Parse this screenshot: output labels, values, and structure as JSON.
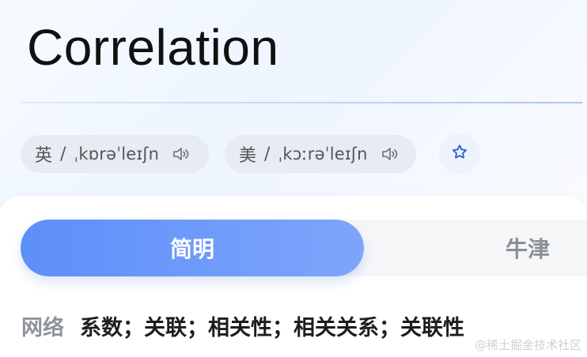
{
  "word": {
    "title": "Correlation"
  },
  "pronunciations": [
    {
      "lang": "英",
      "slash": "/",
      "ipa": "ˌkɒrəˈleɪʃn"
    },
    {
      "lang": "美",
      "slash": "/",
      "ipa": "ˌkɔːrəˈleɪʃn"
    }
  ],
  "tabs": [
    {
      "label": "简明",
      "selected": true
    },
    {
      "label": "牛津",
      "selected": false
    }
  ],
  "definition": {
    "label": "网络",
    "text": "系数；关联；相关性；相关关系；关联性"
  },
  "watermark": "@稀土掘金技术社区",
  "icons": {
    "speaker": "speaker-icon",
    "favorite": "star-icon"
  },
  "colors": {
    "accent": "#5d8ff9",
    "accent_light": "#7ea5fb",
    "pill_bg": "#e7ebf3",
    "muted_text": "#8f949b",
    "title_text": "#111111"
  }
}
